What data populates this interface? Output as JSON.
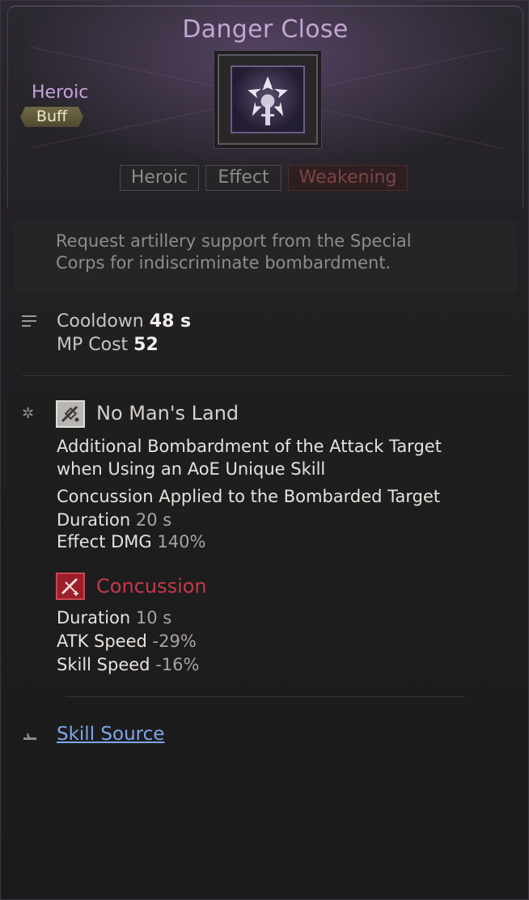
{
  "skill": {
    "title": "Danger Close",
    "rarity": "Heroic",
    "type": "Buff",
    "icon": "artillery-shield-icon"
  },
  "tags": [
    "Heroic",
    "Effect",
    "Weakening"
  ],
  "description": {
    "line1": "Request artillery support from the Special",
    "line2": "Corps for indiscriminate bombardment."
  },
  "stats": {
    "cooldown_label": "Cooldown",
    "cooldown_value": "48 s",
    "mp_label": "MP Cost",
    "mp_value": "52"
  },
  "effect1": {
    "name": "No Man's Land",
    "icon": "bombardment-icon",
    "line1": "Additional Bombardment of the Attack Target",
    "line2": "when Using an AoE Unique Skill",
    "line3": "Concussion Applied to the Bombarded Target",
    "duration_label": "Duration",
    "duration_value": "20 s",
    "dmg_label": "Effect DMG",
    "dmg_value": "140%"
  },
  "effect2": {
    "name": "Concussion",
    "icon": "concussion-icon",
    "duration_label": "Duration",
    "duration_value": "10 s",
    "atk_label": "ATK Speed",
    "atk_value": "-29%",
    "skill_label": "Skill Speed",
    "skill_value": "-16%"
  },
  "source": {
    "label": "Skill Source"
  },
  "colors": {
    "title": "#c2a6d4",
    "rarity": "#c7a3dc",
    "effect1_name": "#d4d0cc",
    "effect2_name": "#c4384a",
    "link": "#7da6e8"
  }
}
